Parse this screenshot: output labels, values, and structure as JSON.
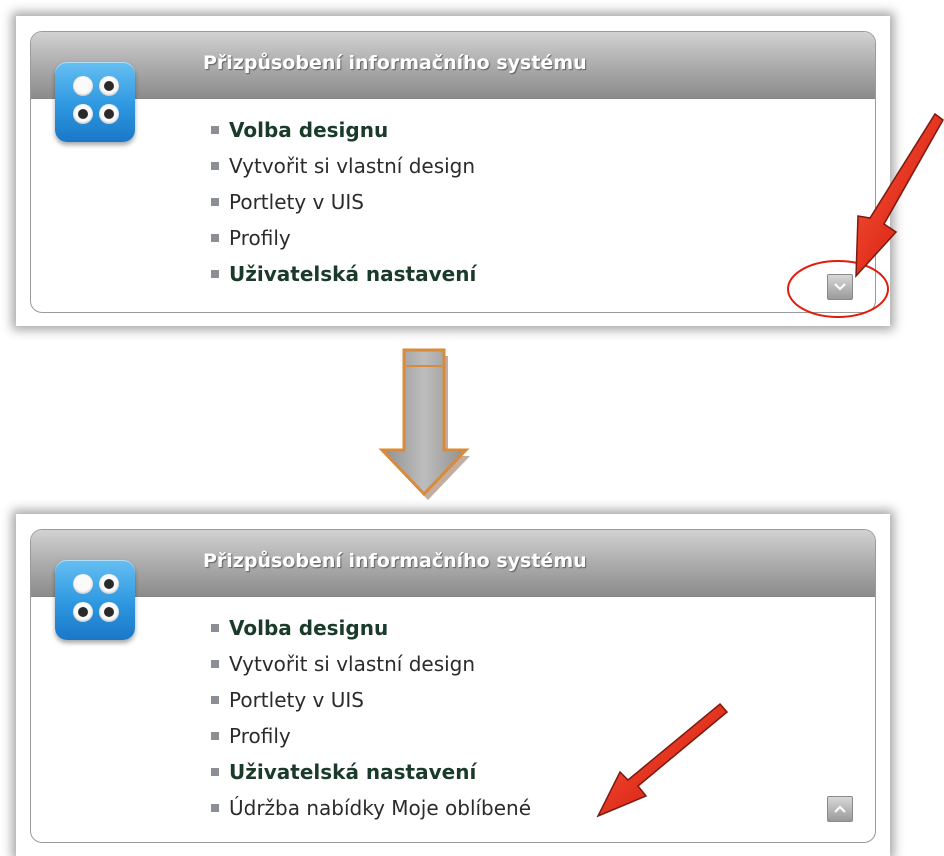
{
  "panels": [
    {
      "title": "Přizpůsobení informačního systému",
      "items": [
        {
          "label": "Volba designu",
          "bold": true
        },
        {
          "label": "Vytvořit si vlastní design",
          "bold": false
        },
        {
          "label": "Portlety v UIS",
          "bold": false
        },
        {
          "label": "Profily",
          "bold": false
        },
        {
          "label": "Uživatelská nastavení",
          "bold": true
        }
      ],
      "toggle_icon": "chevron-down-icon"
    },
    {
      "title": "Přizpůsobení informačního systému",
      "items": [
        {
          "label": "Volba designu",
          "bold": true
        },
        {
          "label": "Vytvořit si vlastní design",
          "bold": false
        },
        {
          "label": "Portlety v UIS",
          "bold": false
        },
        {
          "label": "Profily",
          "bold": false
        },
        {
          "label": "Uživatelská nastavení",
          "bold": true
        },
        {
          "label": "Údržba nabídky Moje oblíbené",
          "bold": false
        }
      ],
      "toggle_icon": "chevron-up-icon"
    }
  ],
  "colors": {
    "annotation_arrow": "#e31b0c",
    "annotation_circle": "#e31b0c",
    "transition_arrow": "#a6a6a6"
  }
}
